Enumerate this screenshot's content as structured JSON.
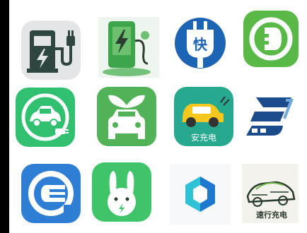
{
  "icons": [
    {
      "name": "charging-station-icon",
      "color": "#3a4a42"
    },
    {
      "name": "green-charger-icon",
      "color": "#3da64a"
    },
    {
      "name": "fast-charge-plug-icon",
      "label": "快",
      "color": "#1e64b4"
    },
    {
      "name": "green-plug-circle-icon",
      "color": "#58b947"
    },
    {
      "name": "car-plug-circle-icon",
      "color": "#30c070"
    },
    {
      "name": "eco-car-leaves-icon",
      "color": "#52b258"
    },
    {
      "name": "yellow-car-icon",
      "label": "安充电",
      "color": "#26a98e"
    },
    {
      "name": "blue-s-logo-icon",
      "color": "#1b4b8a"
    },
    {
      "name": "blue-e-plug-icon",
      "color": "#2e7ed6"
    },
    {
      "name": "rabbit-icon",
      "color": "#40c46a"
    },
    {
      "name": "hexagon-logo-icon",
      "color": "#2ec2d6"
    },
    {
      "name": "sketch-car-icon",
      "label": "速行充电",
      "color": "#2a3a2a"
    }
  ]
}
